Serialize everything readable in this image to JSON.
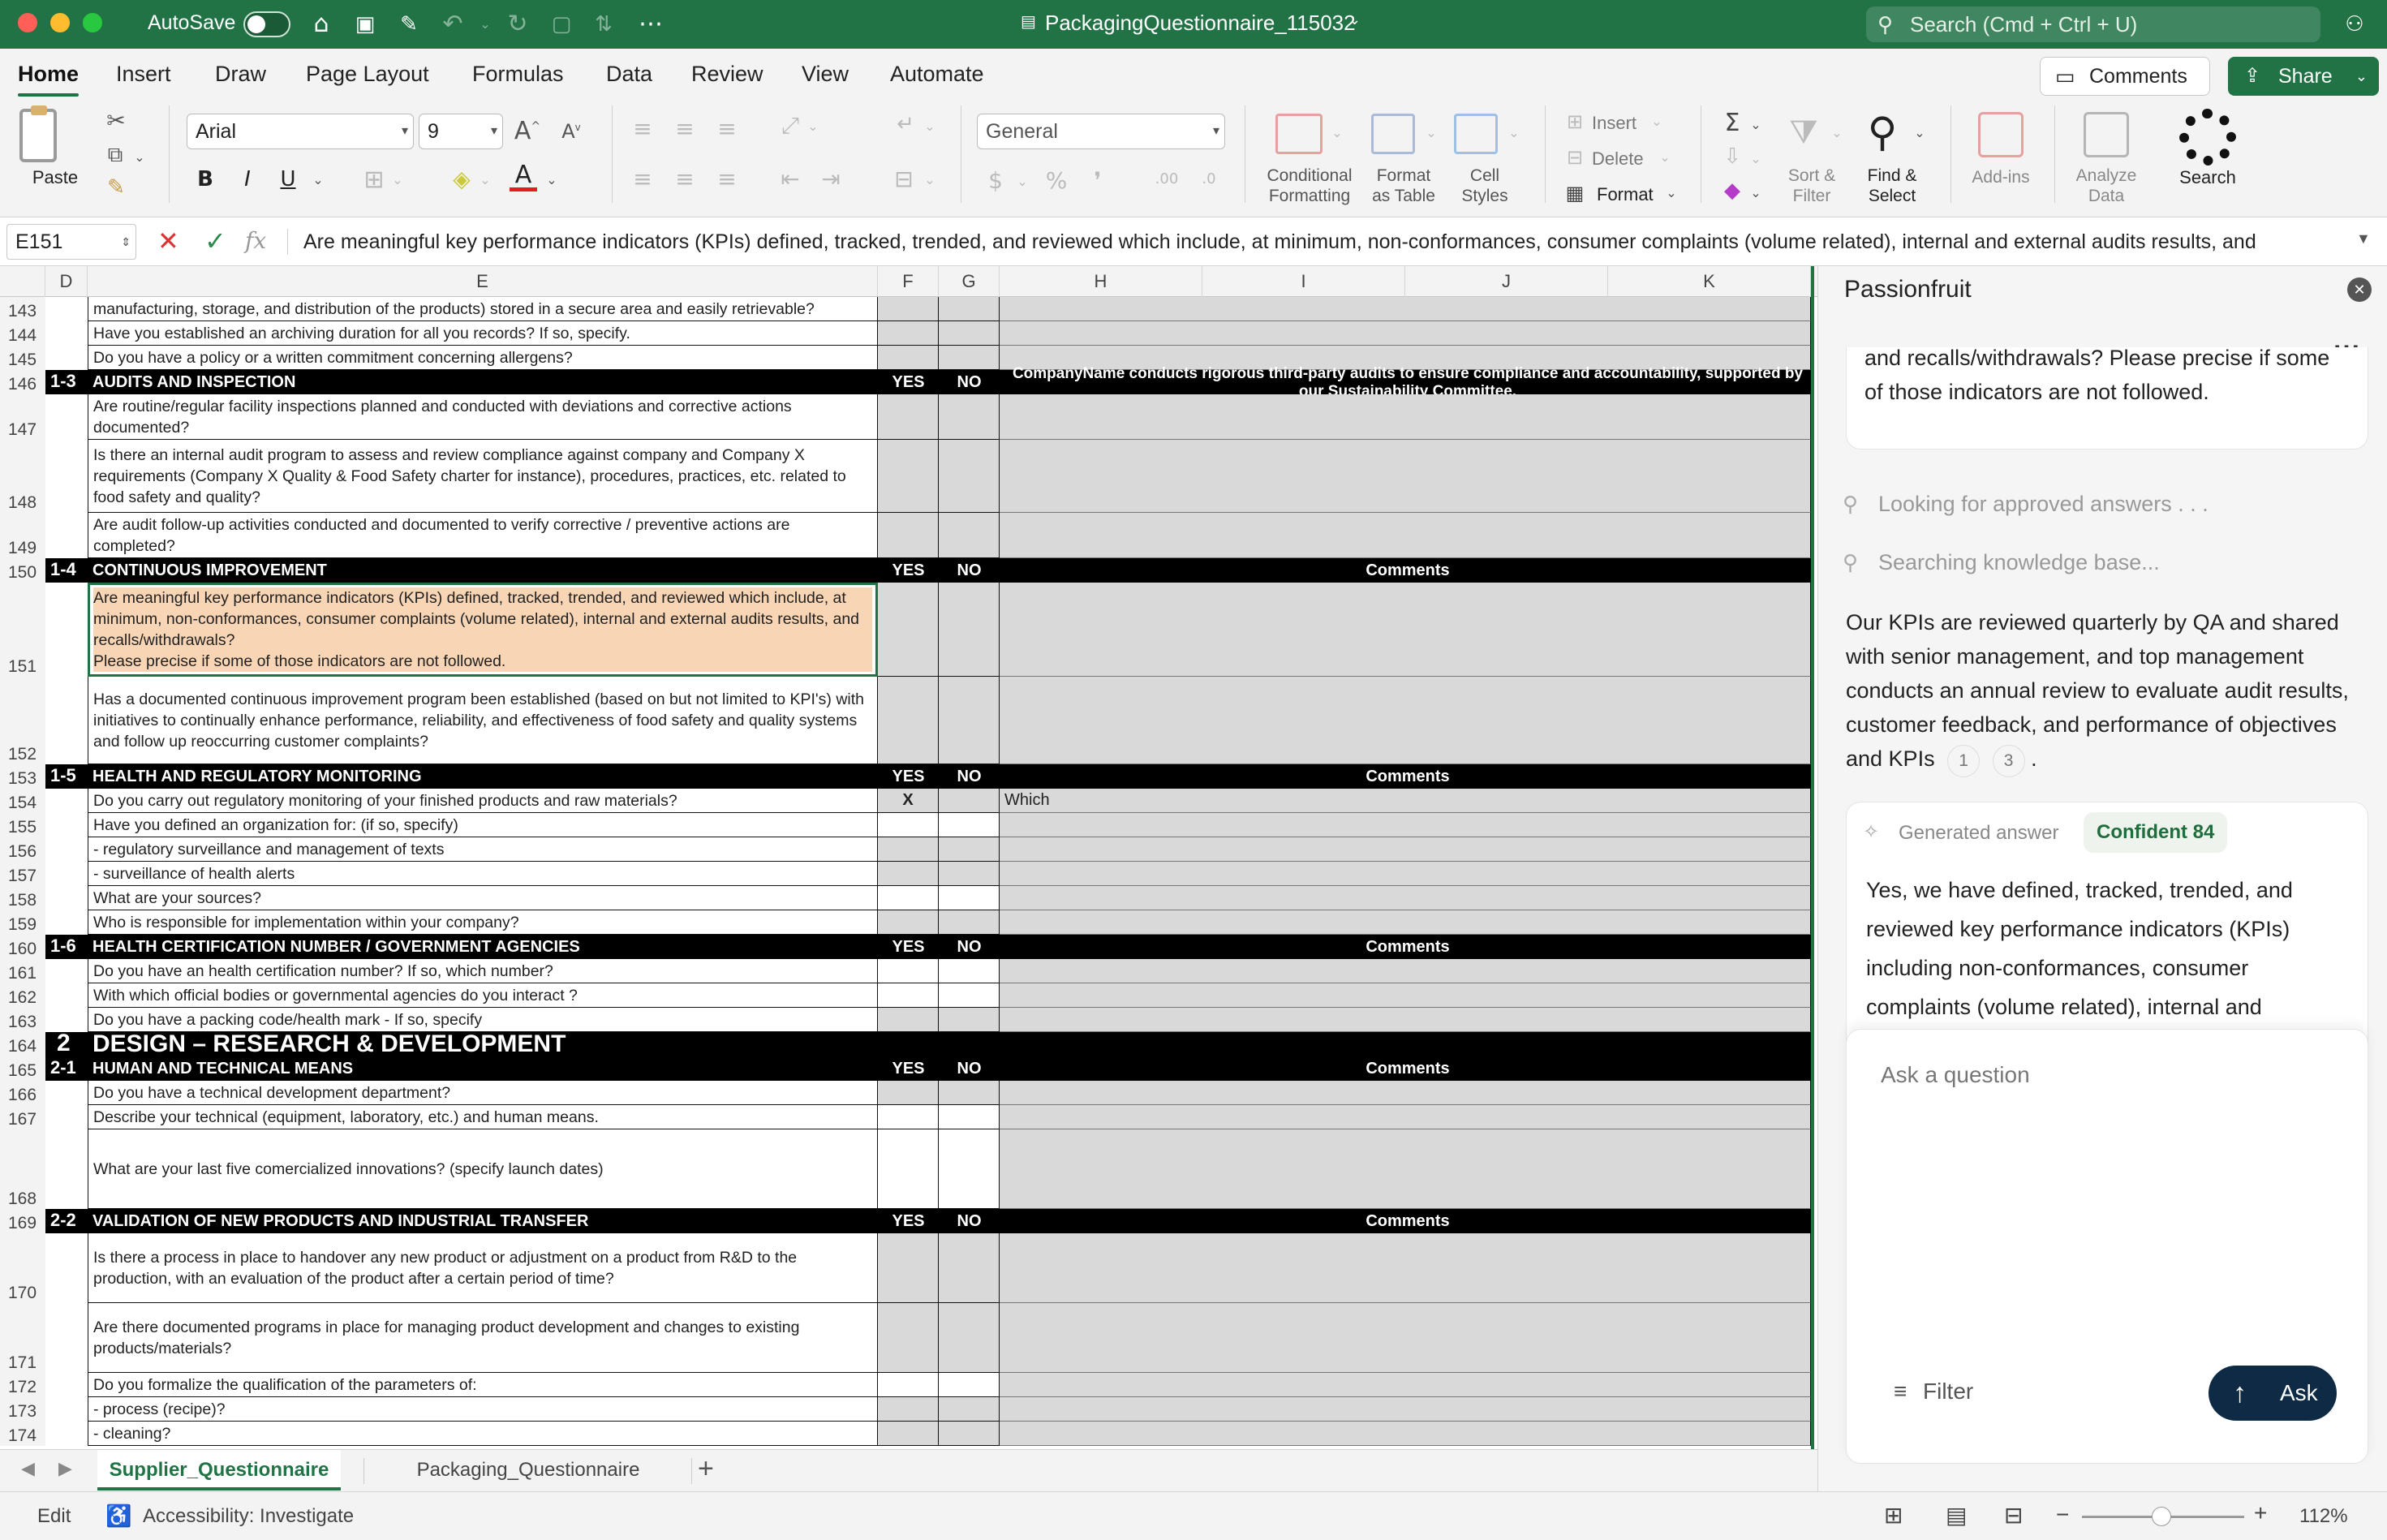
{
  "window": {
    "autosave_label": "AutoSave",
    "title": "PackagingQuestionnaire_115032",
    "search_placeholder": "Search (Cmd + Ctrl + U)"
  },
  "ribbon_tabs": [
    "Home",
    "Insert",
    "Draw",
    "Page Layout",
    "Formulas",
    "Data",
    "Review",
    "View",
    "Automate"
  ],
  "comments_button": "Comments",
  "share_button": "Share",
  "ribbon": {
    "paste": "Paste",
    "font_name": "Arial",
    "font_size": "9",
    "bold": "B",
    "italic": "I",
    "underline": "U",
    "number_format": "General",
    "conditional_formatting": [
      "Conditional",
      "Formatting"
    ],
    "format_as_table": [
      "Format",
      "as Table"
    ],
    "cell_styles": [
      "Cell",
      "Styles"
    ],
    "insert": "Insert",
    "delete": "Delete",
    "format": "Format",
    "sort_filter": [
      "Sort &",
      "Filter"
    ],
    "find_select": [
      "Find &",
      "Select"
    ],
    "add_ins": "Add-ins",
    "analyze_data": [
      "Analyze",
      "Data"
    ],
    "search": "Search"
  },
  "formula_bar": {
    "cell_ref": "E151",
    "content": "Are meaningful key performance indicators (KPIs) defined, tracked, trended, and reviewed which include, at minimum, non-conformances, consumer complaints (volume related), internal and external audits results, and"
  },
  "columns": [
    "D",
    "E",
    "F",
    "G",
    "H",
    "I",
    "J",
    "K"
  ],
  "rows": [
    {
      "num": "143",
      "type": "q",
      "text": "manufacturing, storage, and distribution of the products) stored in a secure area and easily retrievable?",
      "shaded": true
    },
    {
      "num": "144",
      "type": "q",
      "text": "Have you established an archiving duration for all you records? If so, specify.",
      "shaded": true
    },
    {
      "num": "145",
      "type": "q",
      "text": "Do you have a policy or a written commitment concerning allergens?",
      "shaded": true
    },
    {
      "num": "146",
      "type": "sec",
      "code": "1-3",
      "text": "AUDITS AND INSPECTION",
      "yes": "YES",
      "no": "NO",
      "comments": "CompanyName conducts rigorous third-party audits to ensure compliance and accountability, supported by our Sustainability Committee."
    },
    {
      "num": "147",
      "type": "q",
      "text": "Are routine/regular facility inspections planned and conducted with deviations and corrective actions documented?",
      "shaded": true
    },
    {
      "num": "148",
      "type": "q",
      "text": "Is there an internal audit program to assess and review compliance against company and Company X requirements (Company X Quality & Food Safety charter for instance), procedures, practices, etc. related to food safety and quality?",
      "shaded": true
    },
    {
      "num": "149",
      "type": "q",
      "text": "Are audit follow-up activities conducted and documented to verify corrective / preventive actions are completed?",
      "shaded": true
    },
    {
      "num": "150",
      "type": "sec",
      "code": "1-4",
      "text": "CONTINUOUS IMPROVEMENT",
      "yes": "YES",
      "no": "NO",
      "comments": "Comments"
    },
    {
      "num": "151",
      "type": "q",
      "text": "Are meaningful key performance indicators (KPIs) defined, tracked, trended, and reviewed which include, at minimum, non-conformances, consumer complaints (volume related), internal and external audits results, and recalls/withdrawals?\nPlease precise if some of those indicators are not followed.",
      "shaded": true,
      "selected": true
    },
    {
      "num": "152",
      "type": "q",
      "text": "Has a documented continuous improvement program been established (based on but not limited to KPI's) with initiatives to continually enhance performance, reliability, and effectiveness of food safety and quality systems and follow up reoccurring customer complaints?",
      "shaded": true
    },
    {
      "num": "153",
      "type": "sec",
      "code": "1-5",
      "text": "HEALTH AND REGULATORY MONITORING",
      "yes": "YES",
      "no": "NO",
      "comments": "Comments"
    },
    {
      "num": "154",
      "type": "q",
      "text": "Do you carry out regulatory monitoring of your finished products and raw materials?",
      "shaded": true,
      "yesval": "X",
      "comment": "Which"
    },
    {
      "num": "155",
      "type": "q",
      "text": "Have you defined an organization for: (if so, specify)",
      "shaded": false
    },
    {
      "num": "156",
      "type": "q",
      "text": "- regulatory surveillance and management of texts",
      "shaded": true
    },
    {
      "num": "157",
      "type": "q",
      "text": "- surveillance of health alerts",
      "shaded": true
    },
    {
      "num": "158",
      "type": "q",
      "text": "What are your sources?",
      "shaded": false
    },
    {
      "num": "159",
      "type": "q",
      "text": "Who is responsible for implementation within your company?",
      "shaded": true
    },
    {
      "num": "160",
      "type": "sec",
      "code": "1-6",
      "text": "HEALTH CERTIFICATION  NUMBER / GOVERNMENT AGENCIES",
      "yes": "YES",
      "no": "NO",
      "comments": "Comments"
    },
    {
      "num": "161",
      "type": "q",
      "text": "Do you have an health certification number? If so, which number?",
      "shaded": false
    },
    {
      "num": "162",
      "type": "q",
      "text": "With which official bodies or governmental agencies do you interact ?",
      "shaded": false
    },
    {
      "num": "163",
      "type": "q",
      "text": "Do you have a packing code/health mark - If so, specify",
      "shaded": true
    },
    {
      "num": "164",
      "type": "big",
      "code": "2",
      "text": "DESIGN – RESEARCH & DEVELOPMENT"
    },
    {
      "num": "165",
      "type": "sec",
      "code": "2-1",
      "text": "HUMAN AND TECHNICAL MEANS",
      "yes": "YES",
      "no": "NO",
      "comments": "Comments"
    },
    {
      "num": "166",
      "type": "q",
      "text": "Do you have a technical development department?",
      "shaded": true
    },
    {
      "num": "167",
      "type": "q",
      "text": "Describe your technical (equipment, laboratory, etc.) and human means.",
      "shaded": false
    },
    {
      "num": "168",
      "type": "q",
      "text": "What are your last five comercialized innovations? (specify launch dates)",
      "shaded": false
    },
    {
      "num": "169",
      "type": "sec",
      "code": "2-2",
      "text": "VALIDATION OF NEW PRODUCTS AND INDUSTRIAL TRANSFER",
      "yes": "YES",
      "no": "NO",
      "comments": "Comments"
    },
    {
      "num": "170",
      "type": "q",
      "text": "Is there a process in place to handover any new product or adjustment on a product from R&D to the production, with an evaluation of the product after a certain period of time?",
      "shaded": true
    },
    {
      "num": "171",
      "type": "q",
      "text": "Are there documented programs in place for managing product development and changes to existing products/materials?",
      "shaded": true
    },
    {
      "num": "172",
      "type": "q",
      "text": "Do you formalize the qualification of the parameters of:",
      "shaded": false
    },
    {
      "num": "173",
      "type": "q",
      "text": "- process (recipe)?",
      "shaded": true
    },
    {
      "num": "174",
      "type": "q",
      "text": "- cleaning?",
      "shaded": true
    }
  ],
  "sheet_tabs": [
    "Supplier_Questionnaire",
    "Packaging_Questionnaire"
  ],
  "status": {
    "mode": "Edit",
    "accessibility": "Accessibility: Investigate",
    "zoom": "112%"
  },
  "pane": {
    "title": "Passionfruit",
    "prev_card_text": "and recalls/withdrawals? Please precise if some of those indicators are not followed.",
    "status1": "Looking for approved answers . . .",
    "status2": "Searching knowledge base...",
    "answer": "Our KPIs are reviewed quarterly by QA and shared with senior management, and top management conducts an annual review to evaluate audit results, customer feedback, and performance of objectives and KPIs",
    "citations": [
      "1",
      "3"
    ],
    "generated_label": "Generated answer",
    "confidence": "Confident 84",
    "generated_text": "Yes, we have defined, tracked, trended, and reviewed key performance indicators (KPIs) including non-conformances, consumer complaints (volume related), internal and",
    "ask_placeholder": "Ask a question",
    "filter": "Filter",
    "ask_button": "Ask"
  },
  "colors": {
    "excel_green": "#217346",
    "section_black": "#000000",
    "selection_fill": "#f8d5b5",
    "shade": "#d9d9d9"
  }
}
